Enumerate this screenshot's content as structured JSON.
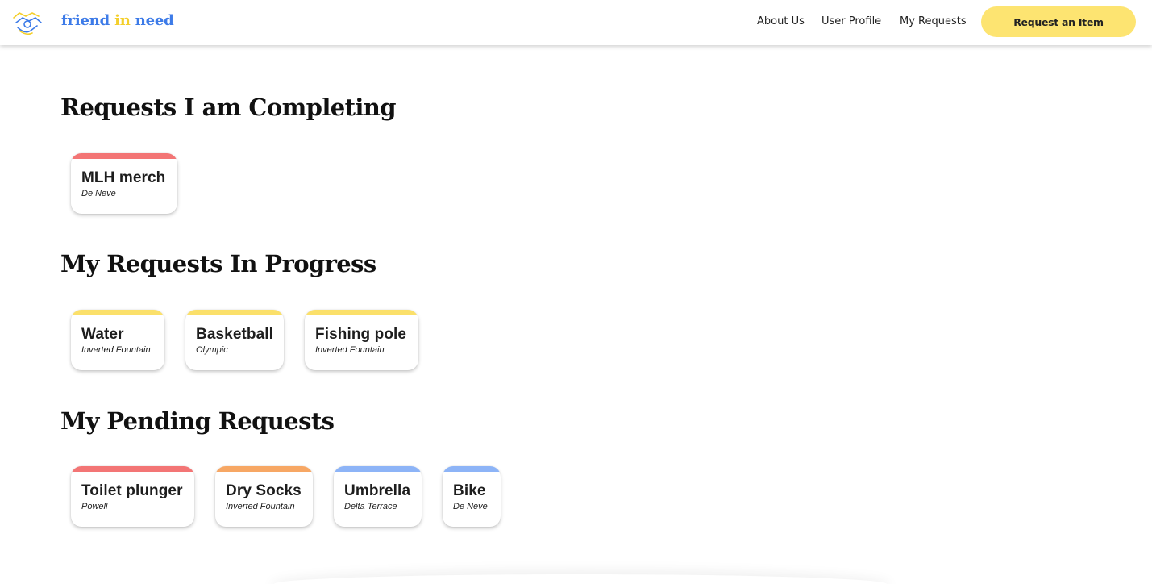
{
  "header": {
    "brand_part1": "friend",
    "brand_part2": "in",
    "brand_part3": "need",
    "nav": [
      {
        "label": "About Us"
      },
      {
        "label": "User Profile"
      },
      {
        "label": "My Requests"
      }
    ],
    "cta_label": "Request an Item",
    "colors": {
      "brand_blue": "#3d7be8",
      "brand_yellow": "#f4cf2c",
      "cta": "#fde471"
    }
  },
  "sections": [
    {
      "title": "Requests I am Completing",
      "cards": [
        {
          "name": "MLH merch",
          "location": "De Neve",
          "color": "#f37575"
        }
      ]
    },
    {
      "title": "My Requests In Progress",
      "cards": [
        {
          "name": "Water",
          "location": "Inverted Fountain",
          "color": "#fbe06a"
        },
        {
          "name": "Basketball",
          "location": "Olympic",
          "color": "#fbe06a"
        },
        {
          "name": "Fishing pole",
          "location": "Inverted Fountain",
          "color": "#fbe06a"
        }
      ]
    },
    {
      "title": "My Pending Requests",
      "cards": [
        {
          "name": "Toilet plunger",
          "location": "Powell",
          "color": "#f37575"
        },
        {
          "name": "Dry Socks",
          "location": "Inverted Fountain",
          "color": "#f7a764"
        },
        {
          "name": "Umbrella",
          "location": "Delta Terrace",
          "color": "#8db4f7"
        },
        {
          "name": "Bike",
          "location": "De Neve",
          "color": "#8db4f7"
        }
      ]
    }
  ]
}
